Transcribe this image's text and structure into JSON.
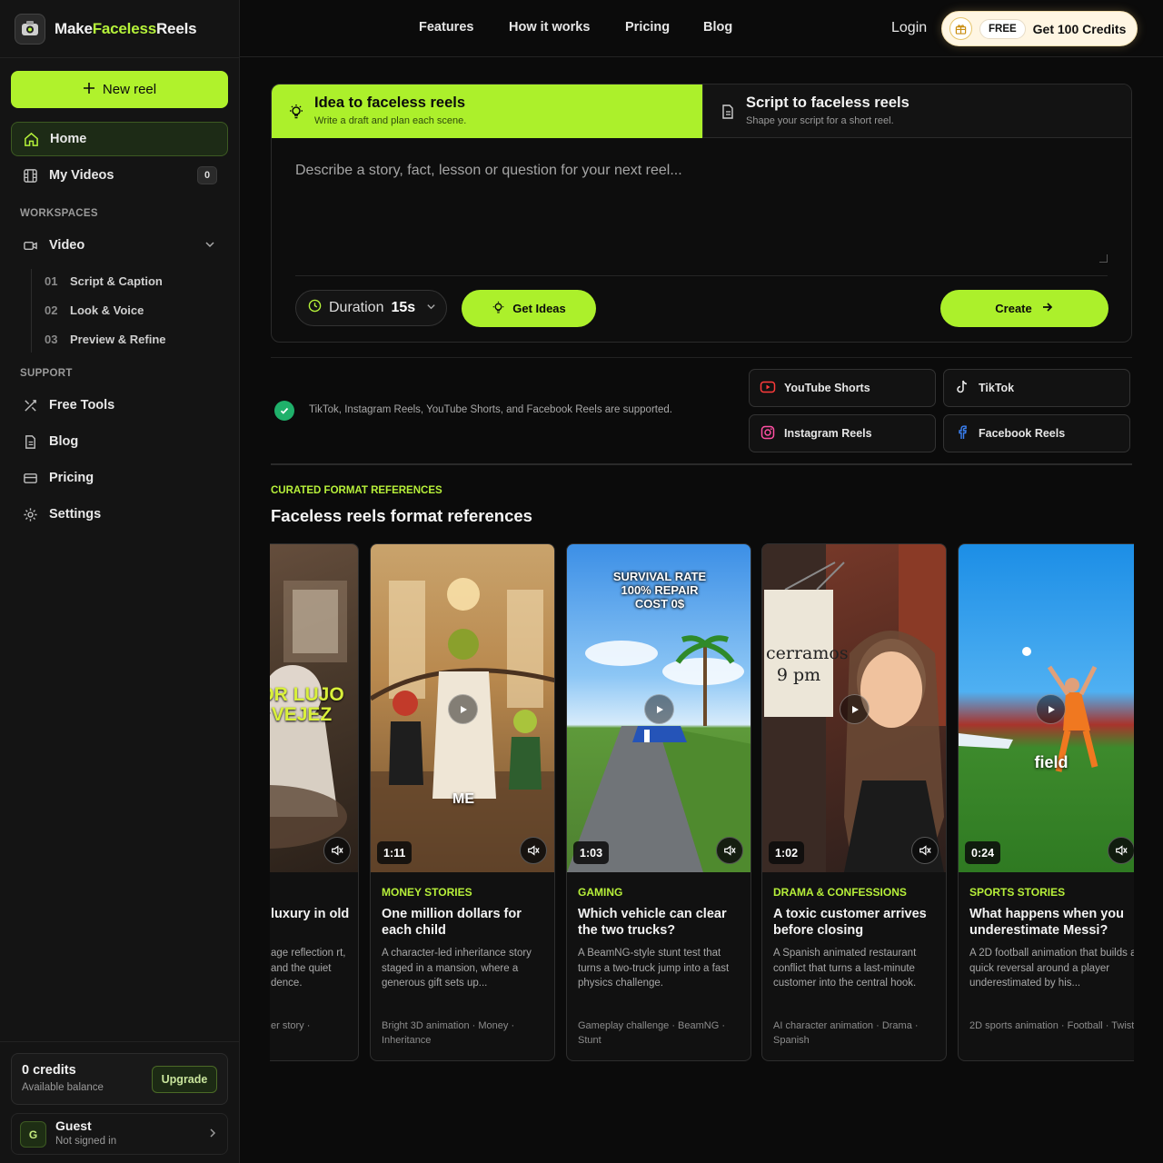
{
  "brand": {
    "make": "Make",
    "faceless": "Faceless",
    "reels": "Reels"
  },
  "sidebar": {
    "new_reel_label": "New reel",
    "nav": [
      {
        "label": "Home",
        "icon": "home-icon"
      },
      {
        "label": "My Videos",
        "icon": "film-icon",
        "count": "0"
      }
    ],
    "workspaces_label": "WORKSPACES",
    "video_label": "Video",
    "steps": [
      {
        "num": "01",
        "label": "Script & Caption"
      },
      {
        "num": "02",
        "label": "Look & Voice"
      },
      {
        "num": "03",
        "label": "Preview & Refine"
      }
    ],
    "support_label": "SUPPORT",
    "support": [
      {
        "label": "Free Tools",
        "icon": "tools-icon"
      },
      {
        "label": "Blog",
        "icon": "document-icon"
      },
      {
        "label": "Pricing",
        "icon": "card-icon"
      },
      {
        "label": "Settings",
        "icon": "gear-icon"
      }
    ],
    "credits": {
      "title": "0 credits",
      "sub": "Available balance",
      "upgrade": "Upgrade"
    },
    "user": {
      "initial": "G",
      "name": "Guest",
      "status": "Not signed in"
    }
  },
  "topnav": {
    "links": [
      "Features",
      "How it works",
      "Pricing",
      "Blog"
    ],
    "login": "Login",
    "cta_badge": "FREE",
    "cta_label": "Get 100 Credits"
  },
  "composer": {
    "tabs": [
      {
        "title": "Idea to faceless reels",
        "sub": "Write a draft and plan each scene."
      },
      {
        "title": "Script to faceless reels",
        "sub": "Shape your script for a short reel."
      }
    ],
    "placeholder": "Describe a story, fact, lesson or question for your next reel...",
    "duration_label": "Duration",
    "duration_value": "15s",
    "get_ideas": "Get Ideas",
    "create": "Create"
  },
  "platforms": {
    "supported_text": "TikTok, Instagram Reels, YouTube Shorts, and Facebook Reels are supported.",
    "items": [
      "YouTube Shorts",
      "TikTok",
      "Instagram Reels",
      "Facebook Reels"
    ]
  },
  "refs": {
    "eyebrow": "CURATED FORMAT REFERENCES",
    "title": "Faceless reels format references",
    "cards": [
      {
        "category": "",
        "title": "luxury in old",
        "desc": "age reflection rt, and the quiet dence.",
        "tags": "er story ·",
        "duration": "",
        "overlay": "OR LUJO VEJEZ"
      },
      {
        "category": "MONEY STORIES",
        "title": "One million dollars for each child",
        "desc": "A character-led inheritance story staged in a mansion, where a generous gift sets up...",
        "tags": "Bright 3D animation · Money · Inheritance",
        "duration": "1:11",
        "overlay": "ME"
      },
      {
        "category": "GAMING",
        "title": "Which vehicle can clear the two trucks?",
        "desc": "A BeamNG-style stunt test that turns a two-truck jump into a fast physics challenge.",
        "tags": "Gameplay challenge · BeamNG · Stunt",
        "duration": "1:03",
        "overlay": "SURVIVAL RATE 100% REPAIR COST 0$"
      },
      {
        "category": "DRAMA & CONFESSIONS",
        "title": "A toxic customer arrives before closing",
        "desc": "A Spanish animated restaurant conflict that turns a last-minute customer into the central hook.",
        "tags": "AI character animation · Drama · Spanish",
        "duration": "1:02",
        "overlay": "cerramos 9 pm"
      },
      {
        "category": "SPORTS STORIES",
        "title": "What happens when you underestimate Messi?",
        "desc": "A 2D football animation that builds a quick reversal around a player underestimated by his...",
        "tags": "2D sports animation · Football · Twist",
        "duration": "0:24",
        "overlay": "field"
      }
    ]
  },
  "colors": {
    "accent": "#acf02b",
    "bg": "#0b0b0b",
    "sidebar": "#141414",
    "success": "#1fb06a"
  }
}
